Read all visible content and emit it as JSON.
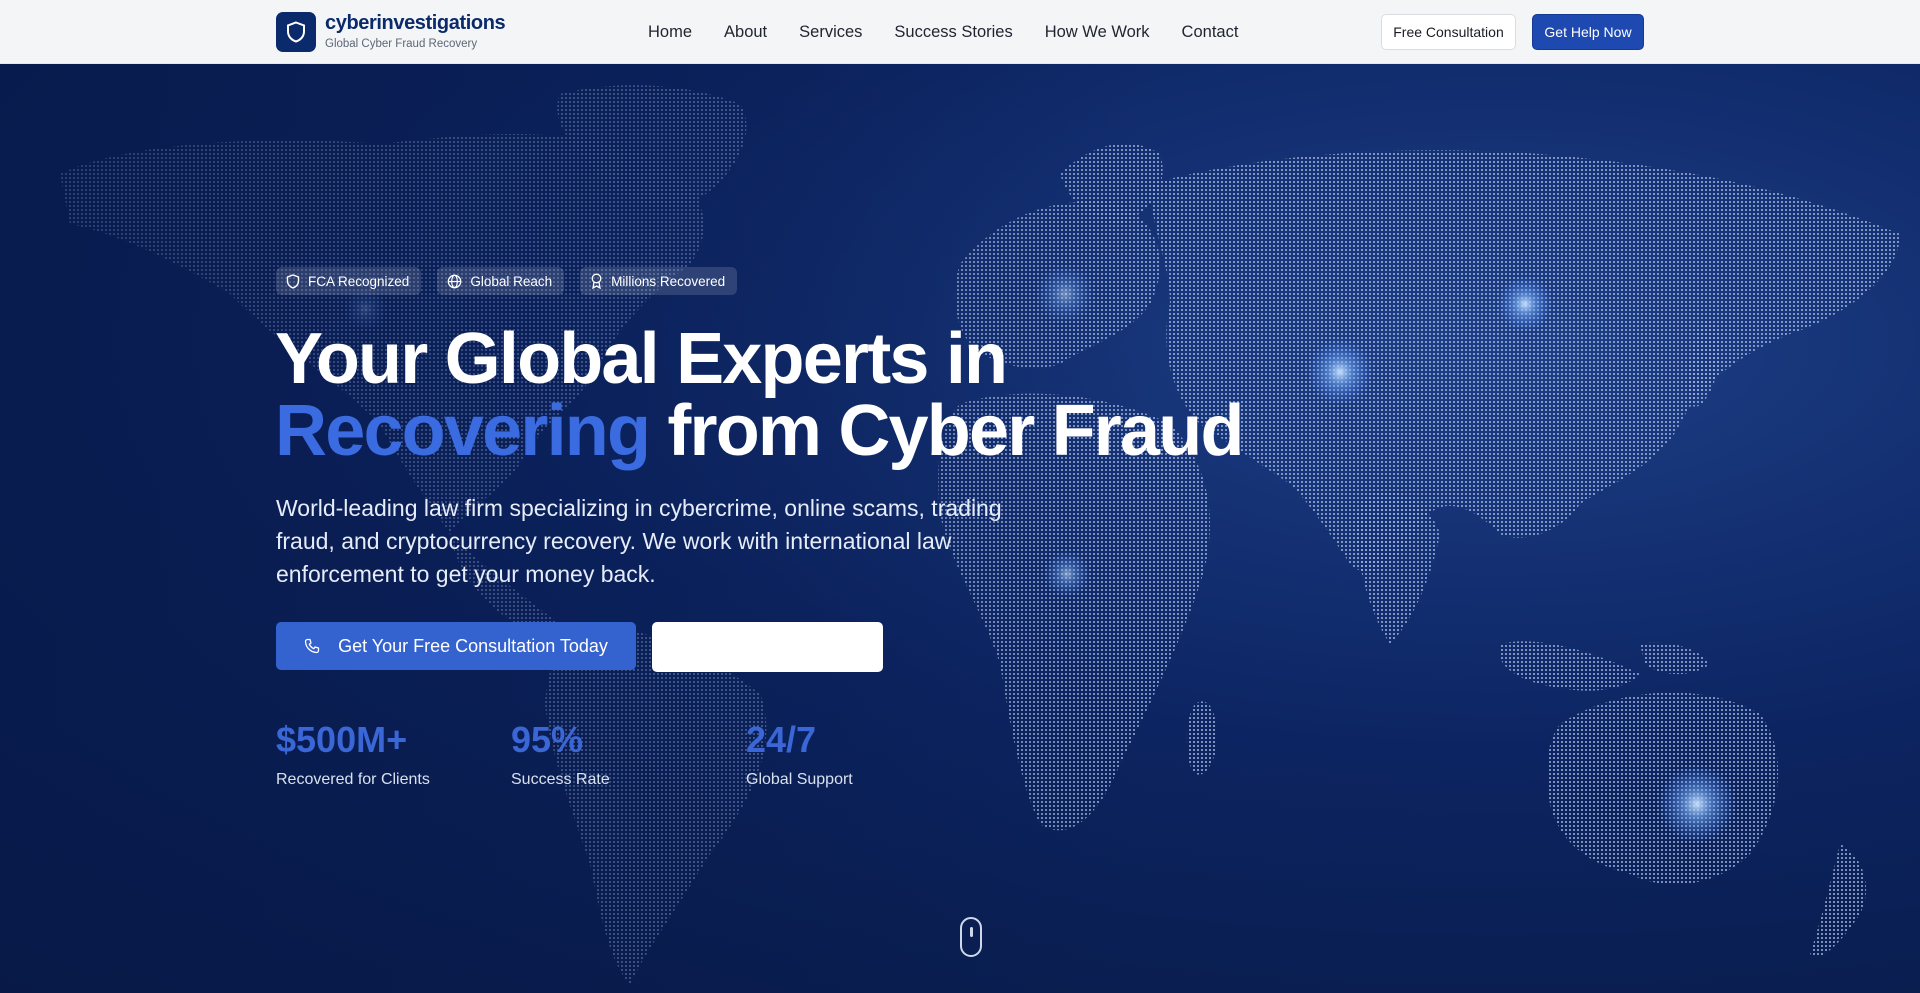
{
  "brand": {
    "name": "cyberinvestigations",
    "tagline": "Global Cyber Fraud Recovery",
    "icon": "shield-icon"
  },
  "nav": {
    "items": [
      "Home",
      "About",
      "Services",
      "Success Stories",
      "How We Work",
      "Contact"
    ]
  },
  "header_buttons": {
    "consultation": "Free Consultation",
    "help": "Get Help Now"
  },
  "hero": {
    "badges": [
      {
        "icon": "shield-icon",
        "label": "FCA Recognized"
      },
      {
        "icon": "globe-icon",
        "label": "Global Reach"
      },
      {
        "icon": "award-icon",
        "label": "Millions Recovered"
      }
    ],
    "headline_part1": "Your Global Experts in",
    "headline_accent": "Recovering",
    "headline_part2": " from Cyber Fraud",
    "subtext": "World-leading law firm specializing in cybercrime, online scams, trading fraud, and cryptocurrency recovery. We work with international law enforcement to get your money back.",
    "cta_primary": "Get Your Free Consultation Today",
    "cta_primary_icon": "phone-icon",
    "cta_secondary": "",
    "stats": [
      {
        "value": "$500M+",
        "label": "Recovered for Clients"
      },
      {
        "value": "95%",
        "label": "Success Rate"
      },
      {
        "value": "24/7",
        "label": "Global Support"
      }
    ]
  },
  "colors": {
    "brand_navy": "#0b2a6b",
    "accent_blue": "#3a6be0",
    "primary_button": "#1e49b0"
  }
}
